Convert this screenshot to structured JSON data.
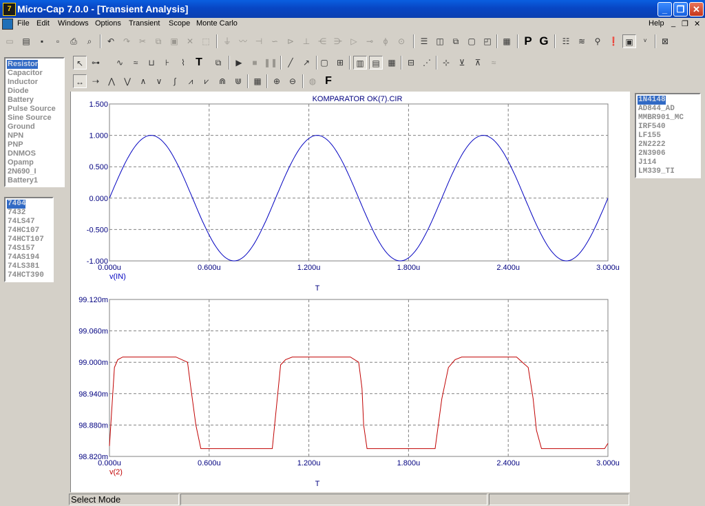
{
  "window": {
    "title": "Micro-Cap 7.0.0 - [Transient Analysis]",
    "app_icon": "7",
    "min_glyph": "_",
    "restore_glyph": "❐",
    "close_glyph": "✕"
  },
  "menu": {
    "items": [
      "File",
      "Edit",
      "Windows",
      "Options",
      "Transient",
      "Scope",
      "Monte Carlo"
    ],
    "help": "Help",
    "mdi_min": "_",
    "mdi_restore": "❐",
    "mdi_close": "✕"
  },
  "toolbar_text": {
    "P": "P",
    "G": "G",
    "T": "T",
    "F": "F"
  },
  "components": [
    "Resistor",
    "Capacitor",
    "Inductor",
    "Diode",
    "Battery",
    "Pulse Source",
    "Sine Source",
    "Ground",
    "NPN",
    "PNP",
    "DNMOS",
    "Opamp",
    "2N690_I",
    "Battery1"
  ],
  "logic_parts": [
    "7404",
    "7432",
    "74LS47",
    "74HC107",
    "74HCT107",
    "74S157",
    "74AS194",
    "74LS381",
    "74HCT390"
  ],
  "models": [
    "1N4148",
    "AD844_AD",
    "MMBR901_MC",
    "IRF540",
    "LF155",
    "2N2222",
    "2N3906",
    "J114",
    "LM339_TI"
  ],
  "status": {
    "mode": "Select Mode"
  },
  "chart_data": [
    {
      "type": "line",
      "title": "KOMPARATOR OK(7).CIR",
      "series_label": "v(IN)",
      "xlabel": "T",
      "x_ticks": [
        "0.000u",
        "0.600u",
        "1.200u",
        "1.800u",
        "2.400u",
        "3.000u"
      ],
      "y_ticks": [
        "1.500",
        "1.000",
        "0.500",
        "0.000",
        "-0.500",
        "-1.000"
      ],
      "xlim": [
        0,
        3.0
      ],
      "ylim": [
        -1.0,
        1.5
      ],
      "grid": true,
      "color": "#0000c0",
      "series": [
        {
          "function": "sine",
          "amplitude": 1.0,
          "frequency_per_us": 1.0,
          "x_start": 0,
          "x_end": 3.0
        }
      ]
    },
    {
      "type": "line",
      "series_label": "v(2)",
      "xlabel": "T",
      "x_ticks": [
        "0.000u",
        "0.600u",
        "1.200u",
        "1.800u",
        "2.400u",
        "3.000u"
      ],
      "y_ticks": [
        "99.120m",
        "99.060m",
        "99.000m",
        "98.940m",
        "98.880m",
        "98.820m"
      ],
      "xlim": [
        0,
        3.0
      ],
      "ylim": [
        98.82,
        99.12
      ],
      "grid": true,
      "color": "#c00000",
      "series": [
        {
          "x": [
            0,
            0.03,
            0.05,
            0.08,
            0.4,
            0.47,
            0.49,
            0.52,
            0.55,
            0.98,
            1.03,
            1.06,
            1.1,
            1.45,
            1.5,
            1.52,
            1.53,
            1.55,
            1.96,
            2.0,
            2.04,
            2.08,
            2.12,
            2.45,
            2.52,
            2.55,
            2.57,
            2.6,
            2.98,
            3.0
          ],
          "y": [
            98.84,
            98.99,
            99.005,
            99.01,
            99.01,
            99.0,
            98.95,
            98.88,
            98.835,
            98.835,
            98.995,
            99.005,
            99.01,
            99.01,
            99.0,
            98.95,
            98.88,
            98.835,
            98.835,
            98.93,
            98.99,
            99.005,
            99.01,
            99.01,
            98.99,
            98.93,
            98.87,
            98.835,
            98.835,
            98.845
          ]
        }
      ]
    }
  ]
}
